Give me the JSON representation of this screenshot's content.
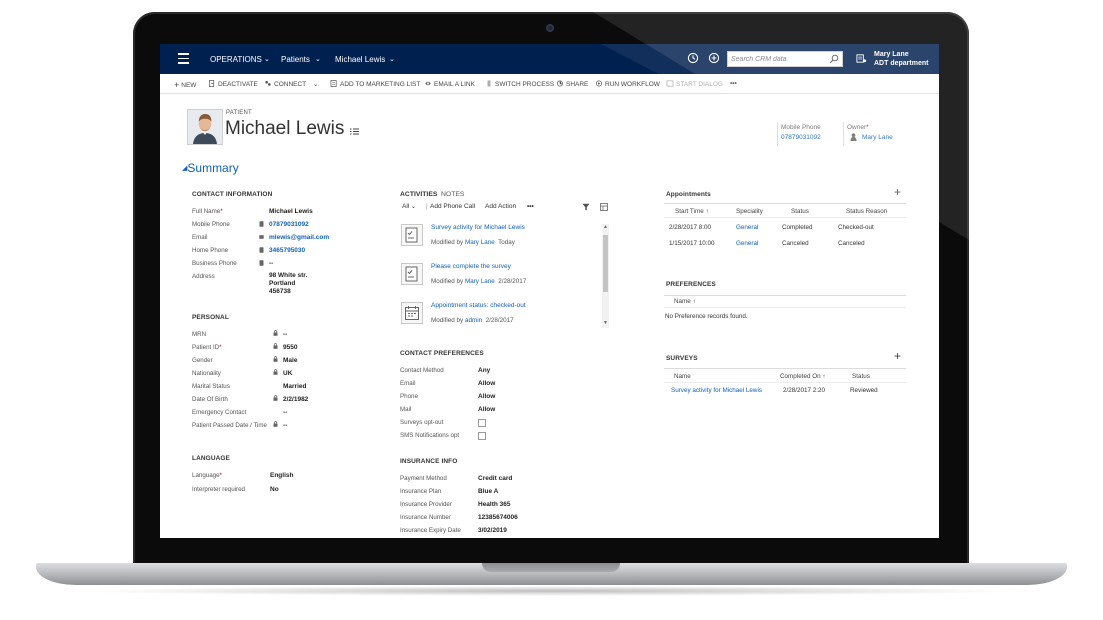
{
  "nav": {
    "app": "OPERATIONS",
    "area": "Patients",
    "record": "Michael Lewis",
    "search_placeholder": "Search CRM data",
    "user_name": "Mary Lane",
    "user_dept": "ADT department",
    "bar_color": "#002050"
  },
  "commands": [
    {
      "label": "NEW",
      "icon": "plus-icon"
    },
    {
      "label": "DEACTIVATE",
      "icon": "deactivate-icon"
    },
    {
      "label": "CONNECT",
      "icon": "connect-icon"
    },
    {
      "label": "ADD TO MARKETING LIST",
      "icon": "marketing-list-icon"
    },
    {
      "label": "EMAIL A LINK",
      "icon": "email-link-icon"
    },
    {
      "label": "SWITCH PROCESS",
      "icon": "switch-process-icon"
    },
    {
      "label": "SHARE",
      "icon": "share-icon"
    },
    {
      "label": "RUN WORKFLOW",
      "icon": "workflow-icon"
    },
    {
      "label": "START DIALOG",
      "icon": "dialog-icon"
    },
    {
      "label": "•••",
      "icon": "more-icon"
    }
  ],
  "header": {
    "entity": "PATIENT",
    "name": "Michael Lewis",
    "mobile_label": "Mobile Phone",
    "mobile_value": "07879031092",
    "owner_label": "Owner",
    "owner_value": "Mary Lane"
  },
  "summary_label": "Summary",
  "contact_info": {
    "title": "CONTACT INFORMATION",
    "fields": [
      {
        "label": "Full Name",
        "value": "Michael Lewis"
      },
      {
        "label": "Mobile Phone",
        "value": "07879031092"
      },
      {
        "label": "Email",
        "value": "mlewis@gmail.com"
      },
      {
        "label": "Home Phone",
        "value": "3465795030"
      },
      {
        "label": "Business Phone",
        "value": "--"
      },
      {
        "label": "Address",
        "value_lines": [
          "98 White str.",
          "Portland",
          "456738"
        ]
      }
    ]
  },
  "personal": {
    "title": "PERSONAL",
    "fields": [
      {
        "label": "MRN",
        "value": "--"
      },
      {
        "label": "Patient ID",
        "value": "9550"
      },
      {
        "label": "Gender",
        "value": "Male"
      },
      {
        "label": "Nationality",
        "value": "UK"
      },
      {
        "label": "Marital Status",
        "value": "Married"
      },
      {
        "label": "Date Of Birth",
        "value": "2/2/1982"
      },
      {
        "label": "Emergency Contact",
        "value": "--"
      },
      {
        "label": "Patient Passed Date / Time",
        "value": "--"
      }
    ]
  },
  "language": {
    "title": "LANGUAGE",
    "fields": [
      {
        "label": "Language",
        "value": "English"
      },
      {
        "label": "Interpreter required",
        "value": "No"
      }
    ]
  },
  "activities": {
    "tab_active": "ACTIVITIES",
    "tab_other": "NOTES",
    "filter": "All",
    "add_phone": "Add Phone Call",
    "add_action": "Add Action",
    "more": "•••",
    "items": [
      {
        "title": "Survey activity for Michael Lewis",
        "modified_by_label": "Modified by",
        "who": "Mary Lane",
        "when": "Today",
        "icon": "survey-icon"
      },
      {
        "title": "Please complete the survey",
        "modified_by_label": "Modified by",
        "who": "Mary Lane",
        "when": "2/28/2017",
        "icon": "survey-icon"
      },
      {
        "title": "Appointment status: checked-out",
        "modified_by_label": "Modified by",
        "who": "admin",
        "when": "2/28/2017",
        "icon": "calendar-icon"
      }
    ]
  },
  "contact_prefs": {
    "title": "CONTACT PREFERENCES",
    "fields": [
      {
        "label": "Contact Method",
        "value": "Any"
      },
      {
        "label": "Email",
        "value": "Allow"
      },
      {
        "label": "Phone",
        "value": "Allow"
      },
      {
        "label": "Mail",
        "value": "Allow"
      },
      {
        "label": "Surveys opt-out",
        "checked": false
      },
      {
        "label": "SMS Notifications opt",
        "checked": false
      }
    ]
  },
  "insurance": {
    "title": "INSURANCE INFO",
    "fields": [
      {
        "label": "Payment Method",
        "value": "Credit card"
      },
      {
        "label": "Insurance Plan",
        "value": "Blue A"
      },
      {
        "label": "Insurance Provider",
        "value": "Health 365"
      },
      {
        "label": "Insurance Number",
        "value": "12385674006"
      },
      {
        "label": "Insurance Expiry Date",
        "value": "3/02/2019"
      }
    ]
  },
  "appointments": {
    "title": "Appointments",
    "columns": [
      "Start Time",
      "Speciality",
      "Status",
      "Status Reason"
    ],
    "rows": [
      [
        "2/28/2017 8:00",
        "General",
        "Completed",
        "Checked-out"
      ],
      [
        "1/15/2017 10:00",
        "General",
        "Canceled",
        "Canceled"
      ]
    ]
  },
  "preferences": {
    "title": "PREFERENCES",
    "columns": [
      "Name"
    ],
    "empty": "No Preference records found."
  },
  "surveys": {
    "title": "SURVEYS",
    "columns": [
      "Name",
      "Completed On",
      "Status"
    ],
    "rows": [
      [
        "Survey activity for Michael Lewis",
        "2/28/2017 2:20",
        "Reviewed"
      ]
    ]
  },
  "colors": {
    "link": "#1160b7",
    "required": "#c00000"
  }
}
